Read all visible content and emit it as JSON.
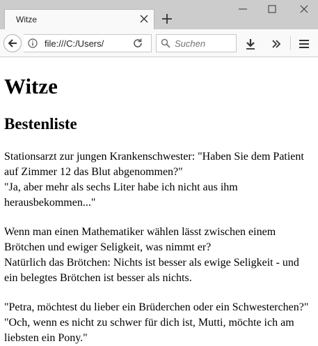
{
  "browser": {
    "tab_title": "Witze",
    "url": "file:///C:/Users/",
    "search_placeholder": "Suchen"
  },
  "page": {
    "title": "Witze",
    "subtitle": "Bestenliste",
    "jokes": [
      {
        "line1": "Stationsarzt zur jungen Krankenschwester: \"Haben Sie dem Patient auf Zimmer 12 das Blut abgenommen?\"",
        "line2": "\"Ja, aber mehr als sechs Liter habe ich nicht aus ihm herausbekommen...\""
      },
      {
        "line1": "Wenn man einen Mathematiker wählen lässt zwischen einem Brötchen und ewiger Seligkeit, was nimmt er?",
        "line2": "Natürlich das Brötchen: Nichts ist besser als ewige Seligkeit - und ein belegtes Brötchen ist besser als nichts."
      },
      {
        "line1": "\"Petra, möchtest du lieber ein Brüderchen oder ein Schwesterchen?\"",
        "line2": "\"Och, wenn es nicht zu schwer für dich ist, Mutti, möchte ich am liebsten ein Pony.\""
      }
    ]
  }
}
